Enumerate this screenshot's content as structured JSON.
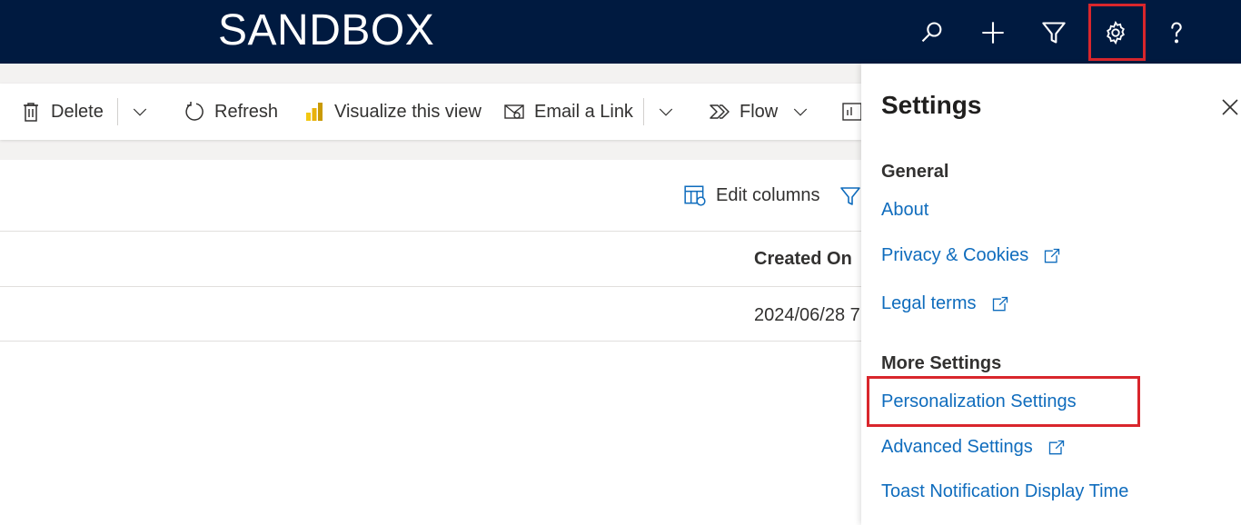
{
  "header": {
    "title": "SANDBOX",
    "icons": [
      "search-icon",
      "plus-icon",
      "filter-icon",
      "gear-icon",
      "help-icon"
    ]
  },
  "commandbar": {
    "delete_label": "Delete",
    "refresh_label": "Refresh",
    "visualize_label": "Visualize this view",
    "email_label": "Email a Link",
    "flow_label": "Flow"
  },
  "grid": {
    "edit_columns_label": "Edit columns",
    "column_header": "Created On",
    "cell_value": "2024/06/28 7"
  },
  "settings": {
    "title": "Settings",
    "general_heading": "General",
    "about": "About",
    "privacy": "Privacy & Cookies",
    "legal": "Legal terms",
    "more_heading": "More Settings",
    "personalization": "Personalization Settings",
    "advanced": "Advanced Settings",
    "toast": "Toast Notification Display Time"
  },
  "colors": {
    "header_bg": "#001a40",
    "link": "#0f6cbd",
    "highlight": "#d9262c"
  }
}
